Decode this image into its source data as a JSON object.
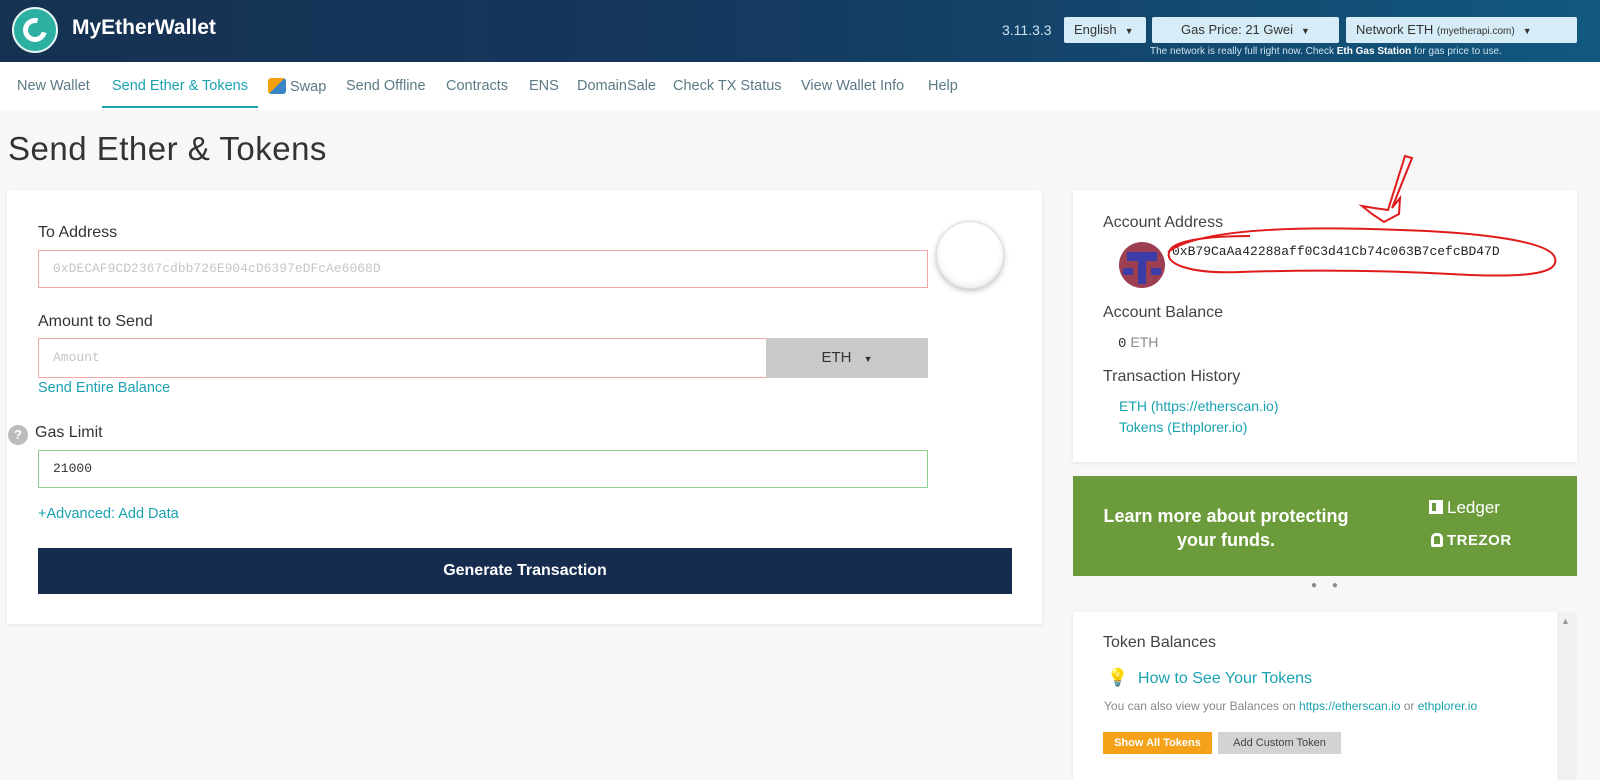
{
  "header": {
    "brand": "MyEtherWallet",
    "version": "3.11.3.3",
    "language": "English",
    "gas_price": "Gas Price: 21 Gwei",
    "network_label": "Network ETH",
    "network_host": "(myetherapi.com)",
    "note_prefix": "The network is really full right now. Check ",
    "note_link": "Eth Gas Station",
    "note_suffix": " for gas price to use."
  },
  "nav": {
    "items": [
      "New Wallet",
      "Send Ether & Tokens",
      "Swap",
      "Send Offline",
      "Contracts",
      "ENS",
      "DomainSale",
      "Check TX Status",
      "View Wallet Info",
      "Help"
    ],
    "active": "Send Ether & Tokens"
  },
  "page_title": "Send Ether & Tokens",
  "form": {
    "to_address_label": "To Address",
    "to_address_placeholder": "0xDECAF9CD2367cdbb726E904cD6397eDFcAe6068D",
    "amount_label": "Amount to Send",
    "amount_placeholder": "Amount",
    "currency": "ETH",
    "send_entire_balance": "Send Entire Balance",
    "gas_limit_label": "Gas Limit",
    "gas_limit_value": "21000",
    "advanced_link": "+Advanced: Add Data",
    "generate_button": "Generate Transaction"
  },
  "account": {
    "address_label": "Account Address",
    "address": "0xB79CaAa42288aff0C3d41Cb74c063B7cefcBD47D",
    "balance_label": "Account Balance",
    "balance_value": "0",
    "balance_unit": "ETH",
    "history_label": "Transaction History",
    "history_eth": "ETH (https://etherscan.io)",
    "history_tokens": "Tokens (Ethplorer.io)"
  },
  "promo": {
    "text": "Learn more about protecting your funds.",
    "ledger": "Ledger",
    "trezor": "TREZOR"
  },
  "tokens": {
    "title": "Token Balances",
    "how_to": "How to See Your Tokens",
    "note_prefix": "You can also view your Balances on ",
    "note_link1": "https://etherscan.io",
    "note_mid": " or ",
    "note_link2": "ethplorer.io",
    "show_all": "Show All Tokens",
    "add_custom": "Add Custom Token"
  },
  "colors": {
    "header_dark": "#163151",
    "accent": "#1ba2b1",
    "generate_bg": "#152c4f",
    "promo_green": "#6b9b3a",
    "show_all_orange": "#f5a21a",
    "annotation_red": "#e01b1b"
  }
}
